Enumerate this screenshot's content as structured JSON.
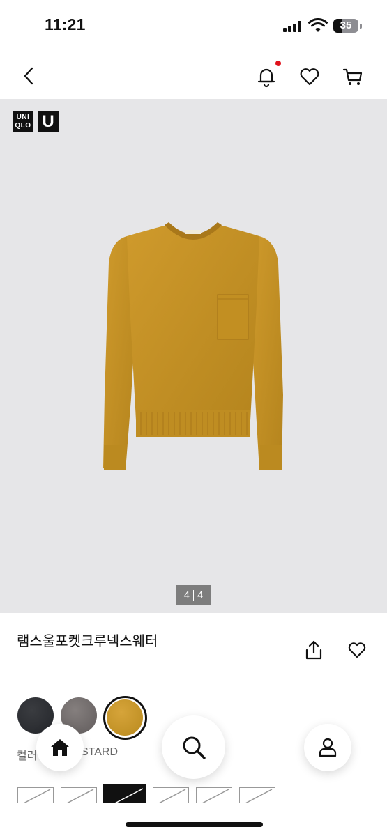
{
  "status_bar": {
    "time": "11:21",
    "battery_level": "35"
  },
  "nav": {
    "back_icon": "chevron-left-icon",
    "notification_icon": "bell-icon",
    "notification_badge_color": "#e0121b",
    "favorites_icon": "heart-icon",
    "cart_icon": "cart-icon"
  },
  "hero": {
    "brand_logo_text": "UNI QLO",
    "brand_u_logo_text": "U",
    "image_color": "#c48f23",
    "page_current": "4",
    "page_total": "4"
  },
  "product": {
    "title": "램스울포켓크루넥스웨터",
    "share_icon": "share-icon",
    "wishlist_icon": "heart-icon"
  },
  "colors": {
    "label": "컬러",
    "selected_value": "STARD",
    "swatches": [
      {
        "name": "black",
        "hex": "#2b2d31"
      },
      {
        "name": "gray",
        "hex": "#716b6b"
      },
      {
        "name": "mustard",
        "hex": "#c4951f",
        "selected": true
      }
    ]
  },
  "floating_nav": {
    "home_icon": "home-icon",
    "search_icon": "search-icon",
    "account_icon": "user-icon"
  }
}
